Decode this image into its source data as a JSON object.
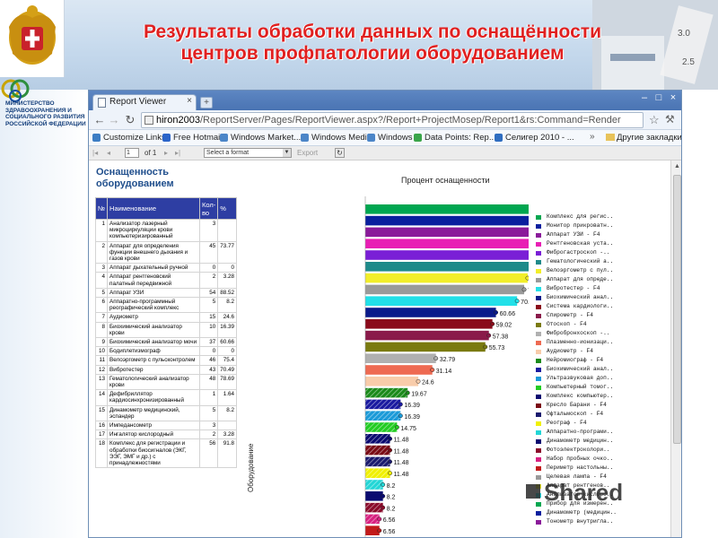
{
  "slide": {
    "title_line1": "Результаты обработки данных по оснащённости",
    "title_line2": "центров профпатологии оборудованием",
    "ministry_text": "МИНИСТЕРСТВО ЗДРАВООХРАНЕНИЯ И СОЦИАЛЬНОГО РАЗВИТИЯ РОССИЙСКОЙ ФЕДЕРАЦИИ",
    "watermark": "Shared"
  },
  "browser": {
    "tab_title": "Report Viewer",
    "url_host": "hiron2003",
    "url_rest": "/ReportServer/Pages/ReportViewer.aspx?/Report+ProjectMosep/Report1&rs:Command=Render",
    "bookmarks": [
      {
        "label": "Customize Links",
        "color": "#3c7dc4"
      },
      {
        "label": "Free Hotmail",
        "color": "#2a64c9"
      },
      {
        "label": "Windows Market...",
        "color": "#4c86c8"
      },
      {
        "label": "Windows Media",
        "color": "#4c86c8"
      },
      {
        "label": "Windows",
        "color": "#4c86c8"
      },
      {
        "label": "Data Points: Rep...",
        "color": "#3aa54a"
      },
      {
        "label": "Селигер 2010 - ...",
        "color": "#2f6dc0"
      }
    ],
    "bookmarks_more": "»",
    "other_bookmarks": "Другие закладки"
  },
  "toolbar": {
    "page_value": "1",
    "of_label": "of 1",
    "format_placeholder": "Select a format",
    "export_label": "Export"
  },
  "report": {
    "heading": "Оснащенность оборудованием",
    "table_headers": [
      "№",
      "Наименование",
      "Кол-во",
      "%"
    ],
    "rows": [
      [
        "1",
        "Анализатор лазерный микроциркуляции крови компьютеризированный",
        "3",
        ""
      ],
      [
        "2",
        "Аппарат для определения функции внешнего дыхания и газов крови",
        "45",
        "73.77"
      ],
      [
        "3",
        "Аппарат дыхательный ручной",
        "0",
        "0"
      ],
      [
        "4",
        "Аппарат рентгеновский палатный передвижной",
        "2",
        "3.28"
      ],
      [
        "5",
        "Аппарат УЗИ",
        "54",
        "88.52"
      ],
      [
        "6",
        "Аппаратно-программный реографический комплекс",
        "5",
        "8.2"
      ],
      [
        "7",
        "Аудиометр",
        "15",
        "24.6"
      ],
      [
        "8",
        "Биохимический анализатор крови",
        "10",
        "16.39"
      ],
      [
        "9",
        "Биохимический анализатор мочи",
        "37",
        "60.66"
      ],
      [
        "10",
        "Бодиплетизмограф",
        "0",
        "0"
      ],
      [
        "11",
        "Велоэргометр с пульсконтролем",
        "46",
        "75.4"
      ],
      [
        "12",
        "Вибротестер",
        "43",
        "70.49"
      ],
      [
        "13",
        "Гематологический анализатор крови",
        "48",
        "78.69"
      ],
      [
        "14",
        "Дефибриллятор кардиосинхронизированный",
        "1",
        "1.64"
      ],
      [
        "15",
        "Динамометр медицинский, эспандер",
        "5",
        "8.2"
      ],
      [
        "16",
        "Импедансометр",
        "3",
        ""
      ],
      [
        "17",
        "Ингалятор кислородный",
        "2",
        "3.28"
      ],
      [
        "18",
        "Комплекс для регистрации и обработки биосигналов (ЭКГ, ЭЭГ, ЭМГ и др.) с принадлежностями",
        "56",
        "91.8"
      ]
    ]
  },
  "chart_data": {
    "type": "bar",
    "title": "Процент оснащенности",
    "ylabel": "Оборудование",
    "orientation": "horizontal",
    "xlim": [
      0,
      100
    ],
    "values": [
      91.8,
      86.89,
      88.52,
      83.6,
      80.33,
      78.69,
      75.4,
      73.77,
      70.49,
      60.66,
      59.02,
      57.38,
      55.73,
      32.79,
      31.14,
      24.6,
      19.67,
      16.39,
      16.39,
      14.75,
      11.48,
      11.48,
      11.48,
      11.48,
      8.2,
      8.2,
      8.2,
      6.56,
      6.56
    ],
    "data_labels": [
      "91.8",
      "86.89",
      "88.52",
      "83.6",
      "80.33",
      "78.69",
      "75.4",
      "73.77",
      "70.49",
      "60.66",
      "59.02",
      "57.38",
      "55.73",
      "32.79",
      "31.14",
      "24.6",
      "19.67",
      "16.39",
      "16.39",
      "14.75",
      "11.48",
      "11.48",
      "11.48",
      "11.48",
      "8.2",
      "8.2",
      "8.2",
      "6.56",
      "6.56"
    ],
    "colors": [
      "#00a650",
      "#0a1f9e",
      "#8a1a9a",
      "#e81eb4",
      "#7a1fd6",
      "#1e8a8a",
      "#f2ee2a",
      "#9a9a9a",
      "#22e0e8",
      "#0a1a8a",
      "#8a0a1a",
      "#8a1a4a",
      "#7a7a10",
      "#b0b0b0",
      "#ee6a52",
      "#f8ccaa",
      "#1a8a1a",
      "#1a1aa0",
      "#1a9ad8",
      "#22cc22",
      "#0a0a70",
      "#7a0a14",
      "#1a1a6e",
      "#f0f000",
      "#22d6d6",
      "#0a0a70",
      "#8a0a2a",
      "#d82080",
      "#c21a1a"
    ],
    "hatched": [
      false,
      false,
      false,
      false,
      false,
      false,
      false,
      false,
      false,
      false,
      false,
      false,
      false,
      false,
      false,
      false,
      true,
      true,
      true,
      true,
      true,
      true,
      true,
      true,
      true,
      false,
      true,
      true,
      false
    ],
    "legend": [
      {
        "label": "Комплекс для регис..",
        "color": "#00a650"
      },
      {
        "label": "Монитор прикроватн..",
        "color": "#0a1f9e"
      },
      {
        "label": "Аппарат УЗИ - F4",
        "color": "#8a1a9a"
      },
      {
        "label": "Рентгеновская уста..",
        "color": "#e81eb4"
      },
      {
        "label": "Фиброгастроскоп -..",
        "color": "#7a1fd6"
      },
      {
        "label": "Гематологический а..",
        "color": "#1e8a8a"
      },
      {
        "label": "Велоэргометр с пул..",
        "color": "#f2ee2a"
      },
      {
        "label": "Аппарат для опреде..",
        "color": "#9a9a9a"
      },
      {
        "label": "Вибротестер - F4",
        "color": "#22e0e8"
      },
      {
        "label": "Биохимический анал..",
        "color": "#0a1a8a"
      },
      {
        "label": "Система кардиологи..",
        "color": "#8a0a1a"
      },
      {
        "label": "Спирометр - F4",
        "color": "#8a1a4a"
      },
      {
        "label": "Отоскоп - F4",
        "color": "#7a7a10"
      },
      {
        "label": "Фибробронхоскоп -..",
        "color": "#b0b0b0"
      },
      {
        "label": "Плазменно-ионизаци..",
        "color": "#ee6a52"
      },
      {
        "label": "Аудиометр - F4",
        "color": "#f8ccaa"
      },
      {
        "label": "Нейромиограф - F4",
        "color": "#1a8a1a"
      },
      {
        "label": "Биохимический анал..",
        "color": "#1a1aa0"
      },
      {
        "label": "Ультразвуковая доп..",
        "color": "#1a9ad8"
      },
      {
        "label": "Компьютерный томог..",
        "color": "#22cc22"
      },
      {
        "label": "Комплекс компьютер..",
        "color": "#0a0a70"
      },
      {
        "label": "Кресло Барани - F4",
        "color": "#7a0a14"
      },
      {
        "label": "Офтальмоскоп - F4",
        "color": "#1a1a6e"
      },
      {
        "label": "Реограф - F4",
        "color": "#f0f000"
      },
      {
        "label": "Аппаратно-програми..",
        "color": "#22d6d6"
      },
      {
        "label": "Динамометр медицин..",
        "color": "#0a0a70"
      },
      {
        "label": "Фотоэлектроколори..",
        "color": "#8a0a2a"
      },
      {
        "label": "Набор пробных очко..",
        "color": "#d82080"
      },
      {
        "label": "Периметр настольны..",
        "color": "#c21a1a"
      },
      {
        "label": "Целевая лампа - F4",
        "color": "#9a9a9a"
      },
      {
        "label": "Аппарат рентгенов..",
        "color": "#f2ee2a"
      },
      {
        "label": "Анализатор кислоро..",
        "color": "#22e0e8"
      },
      {
        "label": "Прибор для измерен..",
        "color": "#00a650"
      },
      {
        "label": "Динамометр (медицин..",
        "color": "#0a1f9e"
      },
      {
        "label": "Тонометр внутригла..",
        "color": "#8a1a9a"
      }
    ]
  }
}
